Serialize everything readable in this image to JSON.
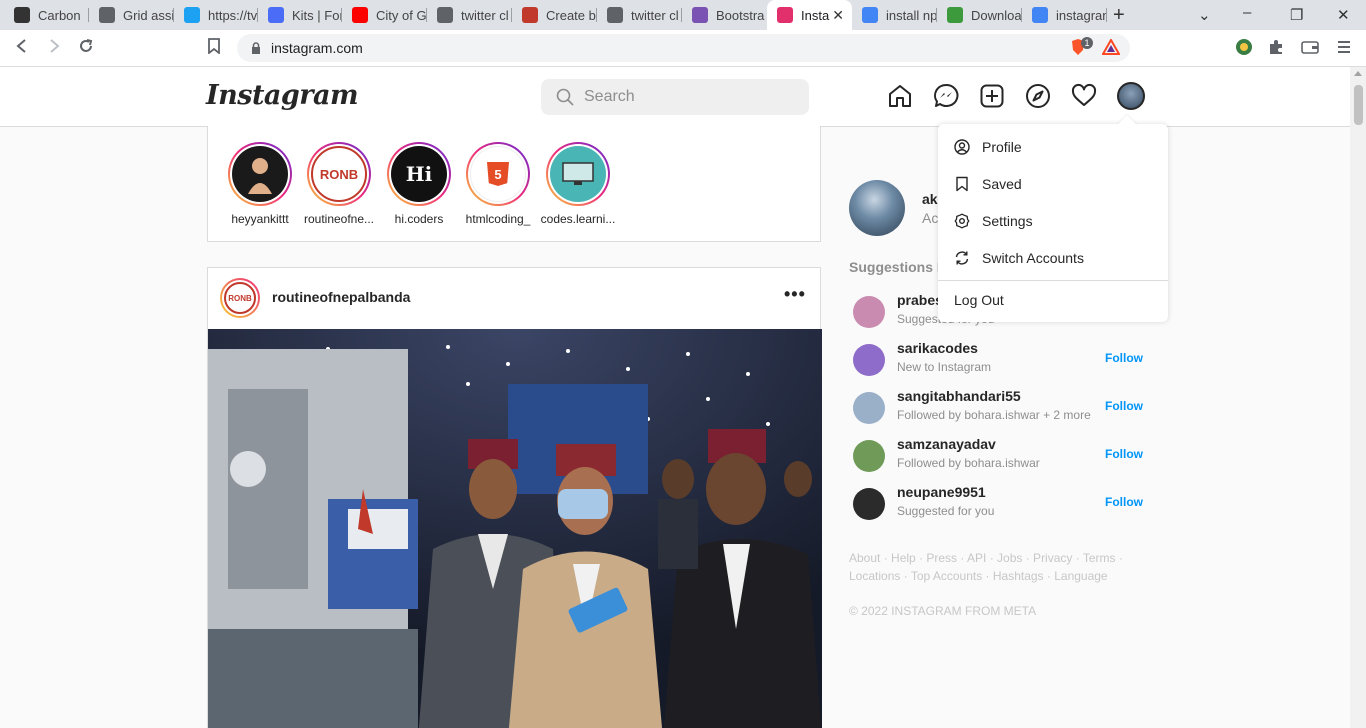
{
  "browser": {
    "tabs": [
      {
        "title": "Carbon",
        "color": "#333"
      },
      {
        "title": "Grid assi",
        "color": "#5f6368"
      },
      {
        "title": "https://tv",
        "color": "#1da1f2"
      },
      {
        "title": "Kits | For",
        "color": "#4a6cf7"
      },
      {
        "title": "City of G",
        "color": "#ff0000"
      },
      {
        "title": "twitter cl",
        "color": "#5f6368"
      },
      {
        "title": "Create b",
        "color": "#c0392b"
      },
      {
        "title": "twitter cl",
        "color": "#5f6368"
      },
      {
        "title": "Bootstra",
        "color": "#7952b3"
      },
      {
        "title": "Insta",
        "color": "#e1306c"
      },
      {
        "title": "install np",
        "color": "#4285f4"
      },
      {
        "title": "Downloa",
        "color": "#3c9a3c"
      },
      {
        "title": "instagran",
        "color": "#4285f4"
      }
    ],
    "url": "instagram.com",
    "shield_badge": "1"
  },
  "header": {
    "logo": "Instagram",
    "search_placeholder": "Search"
  },
  "stories": [
    {
      "name": "heyyankittt",
      "color": "#1a1a1a"
    },
    {
      "name": "routineofne...",
      "color": "#c0392b",
      "label": "RONB"
    },
    {
      "name": "hi.coders",
      "color": "#111",
      "label": "Hi"
    },
    {
      "name": "htmlcoding_",
      "color": "#e44d26",
      "label": "5"
    },
    {
      "name": "codes.learni...",
      "color": "#4ab5b5"
    }
  ],
  "post": {
    "username": "routineofnepalbanda",
    "avatar_label": "RONB",
    "more": "•••"
  },
  "sidebar": {
    "me_name": "ak",
    "me_sub": "Ac",
    "suggestions_title": "Suggestions F",
    "suggestions": [
      {
        "name": "prabes",
        "sub": "Suggested for you",
        "follow": "",
        "color": "#c98bb0"
      },
      {
        "name": "sarikacodes",
        "sub": "New to Instagram",
        "follow": "Follow",
        "color": "#8e6cc9"
      },
      {
        "name": "sangitabhandari55",
        "sub": "Followed by bohara.ishwar + 2 more",
        "follow": "Follow",
        "color": "#9ab0c8"
      },
      {
        "name": "samzanayadav",
        "sub": "Followed by bohara.ishwar",
        "follow": "Follow",
        "color": "#6f9a58"
      },
      {
        "name": "neupane9951",
        "sub": "Suggested for you",
        "follow": "Follow",
        "color": "#2b2b2b"
      }
    ],
    "footer_line1": "About · Help · Press · API · Jobs · Privacy · Terms ·",
    "footer_line2": "Locations · Top Accounts · Hashtags · Language",
    "copyright": "© 2022 INSTAGRAM FROM META"
  },
  "dropdown": {
    "profile": "Profile",
    "saved": "Saved",
    "settings": "Settings",
    "switch_accounts": "Switch Accounts",
    "logout": "Log Out"
  }
}
